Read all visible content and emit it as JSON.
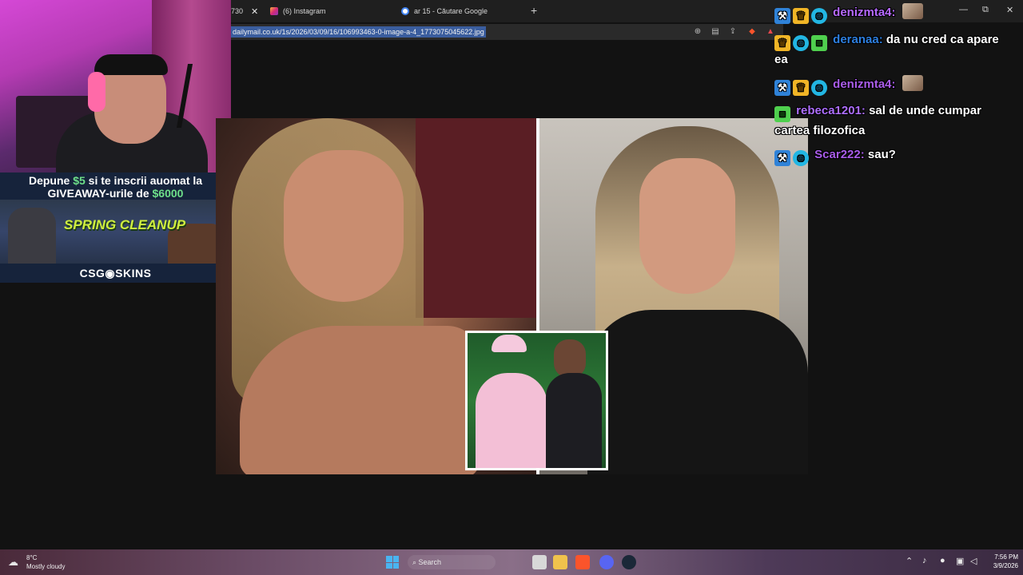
{
  "browser": {
    "tabs": [
      {
        "label": "730",
        "close": "✕"
      },
      {
        "label": "(6) Instagram"
      },
      {
        "label": "ar 15 - Căutare Google"
      }
    ],
    "new_tab": "+",
    "url": "dailymail.co.uk/1s/2026/03/09/16/106993463-0-image-a-4_1773075045622.jpg",
    "window_controls": {
      "minimize": "—",
      "maximize": "⧉",
      "close": "✕"
    }
  },
  "promo": {
    "line1_prefix": "Depune ",
    "line1_amount": "$5",
    "line1_suffix": " si te inscrii auomat la",
    "line2_prefix": "GIVEAWAY-urile de ",
    "line2_amount": "$6000",
    "banner_title": "SPRING CLEANUP",
    "logo": "CSG◉SKINS"
  },
  "chat": {
    "messages": [
      {
        "user": "denizmta4:",
        "text": ""
      },
      {
        "user": "deranaa:",
        "text": "da nu cred ca apare ea"
      },
      {
        "user": "denizmta4:",
        "text": ""
      },
      {
        "user": "rebeca1201:",
        "text": "sal de unde cumpar cartea filozofica"
      },
      {
        "user": "Scar222:",
        "text": "sau?"
      }
    ]
  },
  "taskbar": {
    "weather_temp": "8°C",
    "weather_desc": "Mostly cloudy",
    "search_label": "Search",
    "time": "7:56 PM",
    "date": "3/9/2026"
  },
  "colors": {
    "accent_green": "#6ee08a",
    "chat_purple": "#b569ff",
    "chat_blue": "#2d7fe0",
    "url_highlight": "#3a5d9e"
  }
}
